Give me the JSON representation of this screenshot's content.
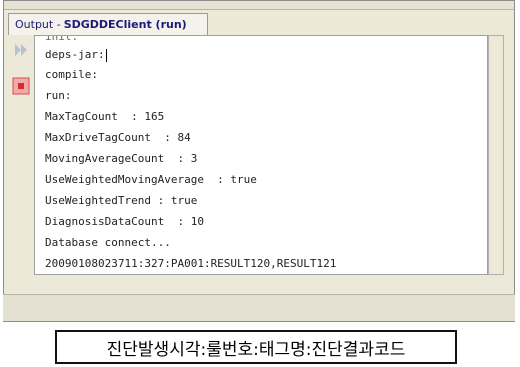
{
  "window": {
    "title_prefix": "Output - ",
    "title_bold": "SDGDDEClient (run)"
  },
  "console": {
    "lines": [
      "init:",
      "deps-jar:",
      "compile:",
      "run:",
      "MaxTagCount  : 165",
      "MaxDriveTagCount  : 84",
      "MovingAverageCount  : 3",
      "UseWeightedMovingAverage  : true",
      "UseWeightedTrend : true",
      "DiagnosisDataCount  : 10",
      "Database connect...",
      "20090108023711:327:PA001:RESULT120,RESULT121"
    ]
  },
  "caption": "진단발생시각:룰번호:태그명:진단결과코드",
  "colors": {
    "highlight": "#e0262d",
    "title_text": "#1b1b7a"
  },
  "icons": {
    "rerun": "rerun-icon",
    "stop": "stop-icon"
  }
}
